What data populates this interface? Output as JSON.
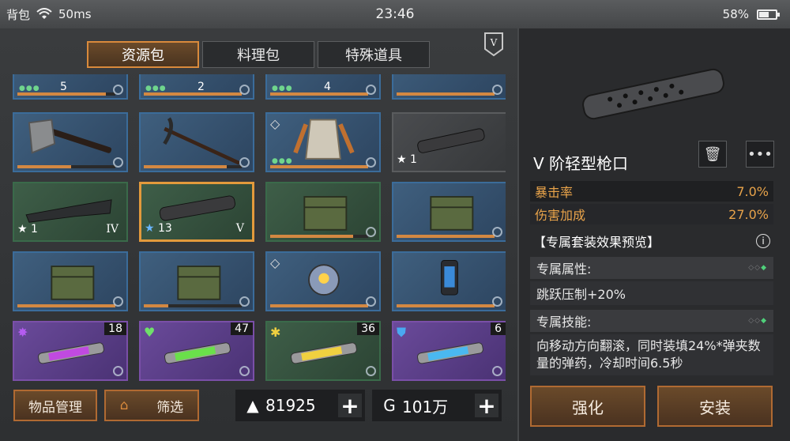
{
  "status": {
    "carrier": "背包",
    "ping": "50ms",
    "time": "23:46",
    "battery": "58%"
  },
  "tabs": [
    {
      "label": "资源包",
      "active": true
    },
    {
      "label": "料理包"
    },
    {
      "label": "特殊道具"
    }
  ],
  "tier_badge": "V",
  "grid": {
    "row0": [
      {
        "count": "5"
      },
      {
        "count": "2"
      },
      {
        "count": "4"
      },
      {
        "count": ""
      }
    ],
    "row1": [
      {
        "name": "axe"
      },
      {
        "name": "pickaxe"
      },
      {
        "name": "armor-vest"
      },
      {
        "name": "muzzle",
        "count": "1"
      }
    ],
    "row2": [
      {
        "name": "stock",
        "count": "1",
        "tier": "IV"
      },
      {
        "name": "muzzle-selected",
        "count": "13",
        "tier": "V"
      },
      {
        "name": "chest"
      },
      {
        "name": "chest"
      }
    ],
    "row3": [
      {
        "name": "chest"
      },
      {
        "name": "chest"
      },
      {
        "name": "drone-core"
      },
      {
        "name": "canister"
      }
    ],
    "row4": [
      {
        "name": "syringe-purple",
        "qty": "18"
      },
      {
        "name": "syringe-green",
        "qty": "47"
      },
      {
        "name": "syringe-yellow",
        "qty": "36"
      },
      {
        "name": "syringe-blue",
        "qty": "6"
      }
    ]
  },
  "footer": {
    "manage_label": "物品管理",
    "filter_label": "筛选",
    "currency1": "81925",
    "currency2": "101万"
  },
  "detail": {
    "name": "V 阶轻型枪口",
    "stats": [
      {
        "label": "暴击率",
        "value": "7.0%"
      },
      {
        "label": "伤害加成",
        "value": "27.0%"
      }
    ],
    "set_title": "【专属套装效果预览】",
    "exclusive_attr_label": "专属属性:",
    "exclusive_attr_value": "跳跃压制+20%",
    "exclusive_skill_label": "专属技能:",
    "exclusive_skill_desc": "向移动方向翻滚，同时装填24%*弹夹数量的弹药，冷却时间6.5秒",
    "enhance_label": "强化",
    "install_label": "安装"
  },
  "colors": {
    "accent": "#d98a3c",
    "stat_text": "#e8a34a",
    "green_dot": "#4fd07a"
  }
}
